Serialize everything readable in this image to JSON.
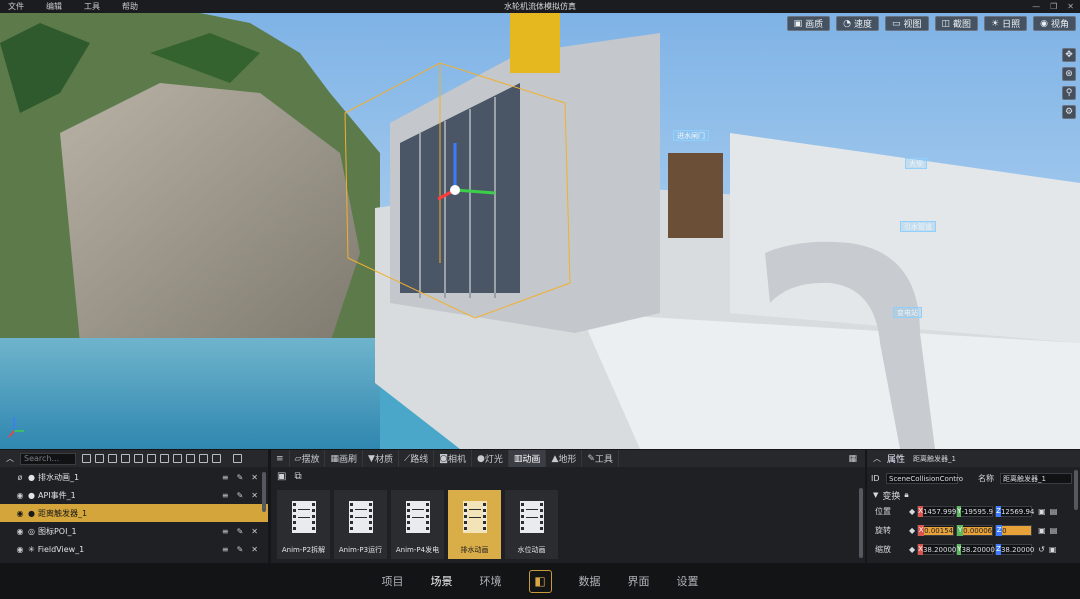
{
  "menu": [
    "文件",
    "编辑",
    "工具",
    "帮助"
  ],
  "window_title": "水轮机流体模拟仿真",
  "view_buttons": [
    {
      "icon": "image-icon",
      "label": "画质"
    },
    {
      "icon": "speed-icon",
      "label": "速度"
    },
    {
      "icon": "camera-icon",
      "label": "视图"
    },
    {
      "icon": "screenshot-icon",
      "label": "截图"
    },
    {
      "icon": "sun-icon",
      "label": "日照"
    },
    {
      "icon": "eye-icon",
      "label": "视角"
    }
  ],
  "side_tools": [
    "move-icon",
    "wheel-icon",
    "person-icon",
    "settings-icon"
  ],
  "scene_tags": {
    "gate": "进水闸门",
    "dam": "大坝",
    "pipe": "引水管道",
    "station": "变电站"
  },
  "scene_panel": {
    "search_placeholder": "Search...",
    "items": [
      {
        "label": "排水动画_1",
        "icon": "bulb-icon",
        "selected": false
      },
      {
        "label": "API事件_1",
        "icon": "bulb-icon",
        "selected": false
      },
      {
        "label": "距离触发器_1",
        "icon": "bulb-icon",
        "selected": true
      },
      {
        "label": "图标POI_1",
        "icon": "poi-icon",
        "selected": false
      },
      {
        "label": "FieldView_1",
        "icon": "sparkle-icon",
        "selected": false
      }
    ]
  },
  "content_tabs": [
    {
      "label": "摆放",
      "active": false
    },
    {
      "label": "画刷",
      "active": false
    },
    {
      "label": "材质",
      "active": false
    },
    {
      "label": "路线",
      "active": false
    },
    {
      "label": "相机",
      "active": false
    },
    {
      "label": "灯光",
      "active": false
    },
    {
      "label": "动画",
      "active": true
    },
    {
      "label": "地形",
      "active": false
    },
    {
      "label": "工具",
      "active": false
    }
  ],
  "assets": [
    {
      "label": "Anim-P2拆解",
      "selected": false
    },
    {
      "label": "Anim-P3运行",
      "selected": false
    },
    {
      "label": "Anim-P4发电",
      "selected": false
    },
    {
      "label": "排水动画",
      "selected": true
    },
    {
      "label": "水位动画",
      "selected": false
    }
  ],
  "props": {
    "title": "属性",
    "object_name": "距离触发器_1",
    "id_label": "ID",
    "id_value": "SceneCollisionContro",
    "name_label": "名称",
    "name_value": "距离触发器_1",
    "transform_label": "变换",
    "position_label": "位置",
    "position": {
      "x": "1457.999",
      "y": "-19595.9",
      "z": "12569.94"
    },
    "rotation_label": "旋转",
    "rotation": {
      "x": "0.00154",
      "y": "0.00006",
      "z": "0"
    },
    "scale_label": "缩放",
    "scale": {
      "x": "38.20000",
      "y": "38.20000",
      "z": "38.20000"
    }
  },
  "bottom_nav": [
    {
      "label": "项目",
      "active": false
    },
    {
      "label": "场景",
      "active": true
    },
    {
      "label": "环境",
      "active": false
    },
    {
      "label": "数据",
      "active": false
    },
    {
      "label": "界面",
      "active": false
    },
    {
      "label": "设置",
      "active": false
    }
  ],
  "colors": {
    "accent": "#d4a53a",
    "panel": "#1e2023",
    "axis_x": "#d9534f",
    "axis_y": "#5cb85c",
    "axis_z": "#e8a23a"
  }
}
